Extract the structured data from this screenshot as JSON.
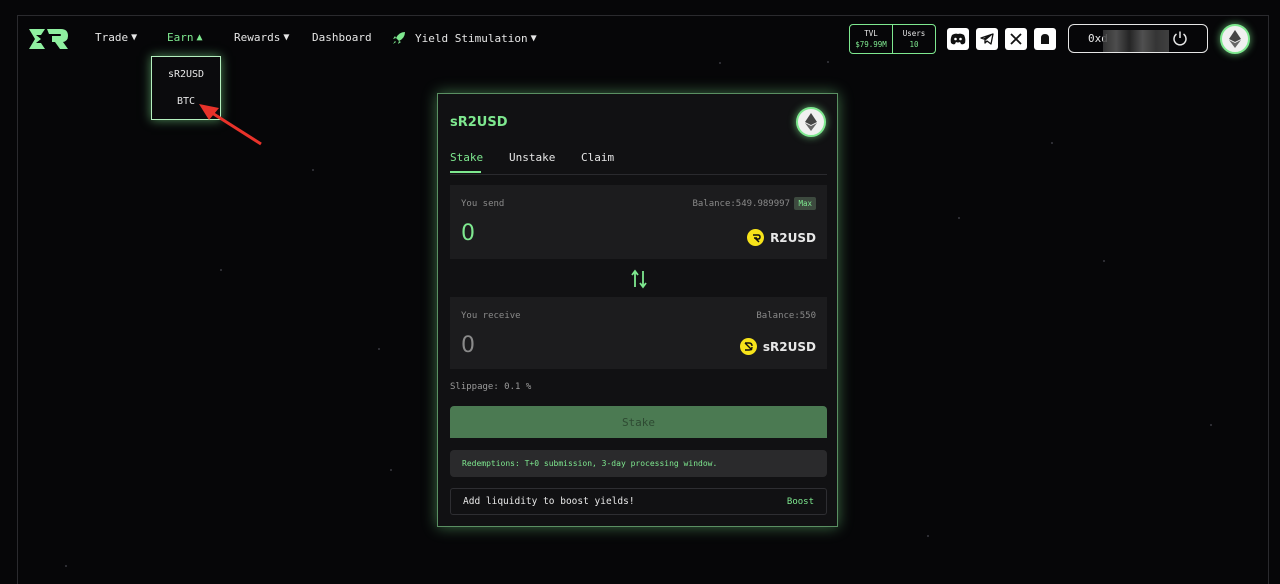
{
  "nav": {
    "items": [
      {
        "label": "Trade",
        "caret": "▼"
      },
      {
        "label": "Earn",
        "caret": "▲"
      },
      {
        "label": "Rewards",
        "caret": "▼"
      },
      {
        "label": "Dashboard"
      },
      {
        "label": "Yield Stimulation",
        "caret": "▼",
        "icon": "rocket-icon"
      }
    ],
    "earn_menu": [
      "sR2USD",
      "BTC"
    ]
  },
  "stats": {
    "tvl_label": "TVL",
    "tvl_value": "$79.99M",
    "users_label": "Users",
    "users_value": "10"
  },
  "socials": [
    "discord-icon",
    "telegram-icon",
    "x-icon",
    "ghost-icon"
  ],
  "wallet": {
    "address_prefix": "0xd"
  },
  "card": {
    "title": "sR2USD",
    "tabs": [
      "Stake",
      "Unstake",
      "Claim"
    ],
    "active_tab": "Stake",
    "send": {
      "label": "You send",
      "balance": "Balance:549.989997",
      "max_label": "Max",
      "amount": "0",
      "token": "R2USD"
    },
    "receive": {
      "label": "You receive",
      "balance": "Balance:550",
      "amount": "0",
      "token": "sR2USD"
    },
    "slippage": "Slippage: 0.1 %",
    "stake_button": "Stake",
    "redemption_note": "Redemptions: T+0 submission, 3-day processing window.",
    "boost_text": "Add liquidity to boost yields!",
    "boost_link": "Boost"
  },
  "colors": {
    "accent": "#7ee88f",
    "background": "#060608",
    "card_bg": "#111113",
    "stake_button": "#4b7a52",
    "token_yellow": "#f7e31a",
    "annotation_arrow": "#e8322a"
  }
}
